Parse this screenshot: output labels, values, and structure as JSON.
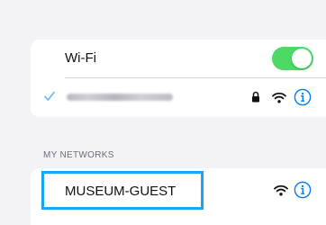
{
  "wifi_section": {
    "wifi_label": "Wi-Fi",
    "wifi_toggle_on": true,
    "connected_network_name": "",
    "connected_network_blurred": true,
    "connected_network_icons": [
      "checkmark-icon",
      "lock-icon",
      "wifi-signal-icon",
      "info-icon"
    ]
  },
  "my_networks": {
    "header": "MY NETWORKS",
    "items": [
      {
        "name": "MUSEUM-GUEST",
        "icons": [
          "wifi-signal-icon",
          "info-icon"
        ],
        "highlighted": true
      }
    ]
  },
  "colors": {
    "background": "#f2f2f7",
    "toggle_on": "#4cd964",
    "accent_blue": "#007aff",
    "highlight_border": "#1aa7ef"
  }
}
